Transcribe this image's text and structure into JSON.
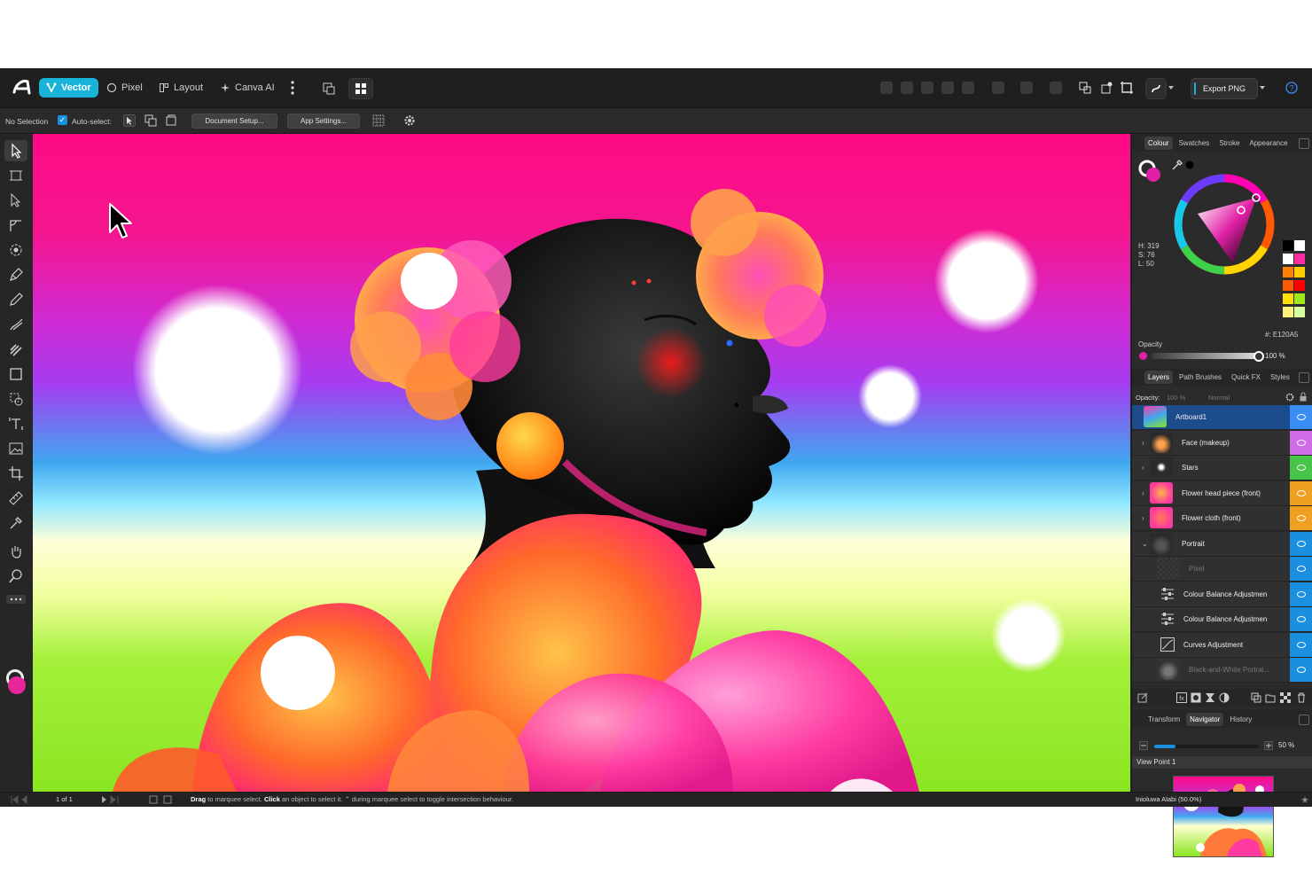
{
  "toolbar": {
    "personas": [
      {
        "label": "Vector",
        "icon": "vector-persona-icon",
        "active": true
      },
      {
        "label": "Pixel",
        "icon": "pixel-persona-icon",
        "active": false
      },
      {
        "label": "Layout",
        "icon": "layout-persona-icon",
        "active": false
      },
      {
        "label": "Canva AI",
        "icon": "canva-ai-icon",
        "active": false
      }
    ],
    "export_label": "Export PNG",
    "accent": "#18b3d9"
  },
  "context": {
    "selection": "No Selection",
    "auto_select_label": "Auto-select:",
    "auto_select_checked": true,
    "document_setup": "Document Setup...",
    "app_settings": "App Settings..."
  },
  "colour_panel": {
    "tabs": [
      "Colour",
      "Swatches",
      "Stroke",
      "Appearance"
    ],
    "active_tab": "Colour",
    "h": "H: 319",
    "s": "S: 76",
    "l": "L: 50",
    "hex_label": "#: E120A5",
    "opacity_label": "Opacity",
    "opacity_value": "100 %",
    "current_color": "#e120a5",
    "swatches": [
      "#000000",
      "#ffffff",
      "#ffffff",
      "#ff2ea0",
      "#ff7f00",
      "#ffcc00",
      "#ff5a00",
      "#ff0000",
      "#ffe000",
      "#9ee81e",
      "#fff07a",
      "#d9ff9e"
    ]
  },
  "layers_panel": {
    "tabs": [
      "Layers",
      "Path Brushes",
      "Quick FX",
      "Styles"
    ],
    "active_tab": "Layers",
    "opacity_label": "Opacity:",
    "opacity_value": "100 %",
    "blend_mode": "Normal",
    "layers": [
      {
        "name": "Artboard1",
        "selected": true,
        "tag": "#3a8df5"
      },
      {
        "name": "Face (makeup)",
        "selected": false,
        "tag": "#d06ce6"
      },
      {
        "name": "Stars",
        "selected": false,
        "tag": "#48c44a"
      },
      {
        "name": "Flower head piece (front)",
        "selected": false,
        "tag": "#f0a020"
      },
      {
        "name": "Flower cloth (front)",
        "selected": false,
        "tag": "#f0a020"
      },
      {
        "name": "Portrait",
        "selected": false,
        "tag": "#1a8fe0"
      },
      {
        "name": "Pixel",
        "selected": false,
        "tag": "#1a8fe0",
        "dim": true
      },
      {
        "name": "Colour Balance Adjustmen",
        "selected": false,
        "tag": "#1a8fe0"
      },
      {
        "name": "Colour Balance Adjustmen",
        "selected": false,
        "tag": "#1a8fe0"
      },
      {
        "name": "Curves Adjustment",
        "selected": false,
        "tag": "#1a8fe0"
      },
      {
        "name": "Black-and-White Portrai...",
        "selected": false,
        "tag": "#1a8fe0",
        "dim": true
      }
    ]
  },
  "navigator_panel": {
    "tabs": [
      "Transform",
      "Navigator",
      "History"
    ],
    "active_tab": "Navigator",
    "zoom_value": "50 %",
    "zoom_fraction": 0.2,
    "view_point": "View Point 1"
  },
  "status": {
    "page": "1 of 1",
    "hint_drag": "Drag",
    "hint_1": " to marquee select. ",
    "hint_click": "Click",
    "hint_2": " an object to select it. ⌃ during marquee select to toggle intersection behaviour.",
    "author": "Inioluwa Alabi (50.0%)"
  }
}
